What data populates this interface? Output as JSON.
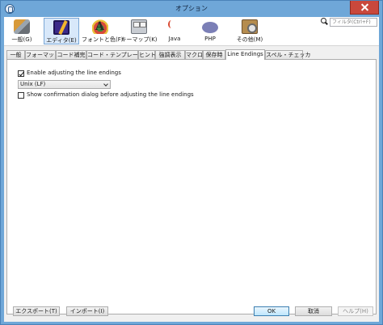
{
  "window": {
    "title": "オプション"
  },
  "categories": [
    {
      "label": "一般(G)",
      "icon": "wrench-gear-icon"
    },
    {
      "label": "エディタ(E)",
      "icon": "editor-pencil-icon"
    },
    {
      "label": "フォントと色(F)",
      "icon": "font-color-icon"
    },
    {
      "label": "キーマップ(K)",
      "icon": "keyboard-icon"
    },
    {
      "label": "Java",
      "icon": "java-icon"
    },
    {
      "label": "PHP",
      "icon": "php-icon"
    },
    {
      "label": "その他(M)",
      "icon": "misc-gear-icon"
    }
  ],
  "search": {
    "placeholder": "フィルタ(Ctrl+F)"
  },
  "tabs": [
    "一般",
    "フォーマット",
    "コード補完",
    "コード・テンプレート",
    "ヒント",
    "強調表示",
    "マクロ",
    "保存時",
    "Line Endings",
    "スペル・チェッカ"
  ],
  "active_tab": "Line Endings",
  "settings": {
    "enable_adjusting_label": "Enable adjusting the line endings",
    "enable_adjusting_checked": true,
    "line_ending_value": "Unix (LF)",
    "show_confirm_label": "Show confirmation dialog before adjusting the line endings",
    "show_confirm_checked": false
  },
  "buttons": {
    "export": "エクスポート(T)",
    "import": "インポート(I)",
    "ok": "OK",
    "cancel": "取消",
    "help": "ヘルプ(H)"
  }
}
